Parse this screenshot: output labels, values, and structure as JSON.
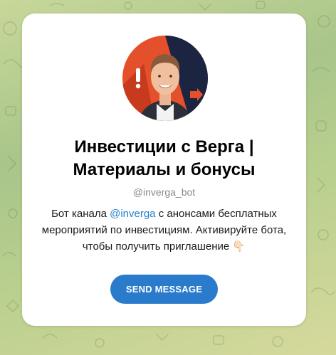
{
  "bot": {
    "title_line1": "Инвестиции с Верга |",
    "title_line2": "Материалы и бонусы",
    "username": "@inverga_bot",
    "description": {
      "before_link": "Бот канала ",
      "link": "@inverga",
      "after_link": " с анонсами бесплатных мероприятий по инвестициям. Активируйте бота, чтобы получить приглашение ",
      "emoji": "👇🏻"
    }
  },
  "actions": {
    "send_message_label": "SEND MESSAGE"
  },
  "avatar": {
    "icon": "exclamation-icon"
  },
  "colors": {
    "accent": "#2a7bcb",
    "link": "#2481cc",
    "card": "#ffffff",
    "avatar_bg_orange": "#e4502b",
    "avatar_bg_navy": "#1b2440"
  }
}
